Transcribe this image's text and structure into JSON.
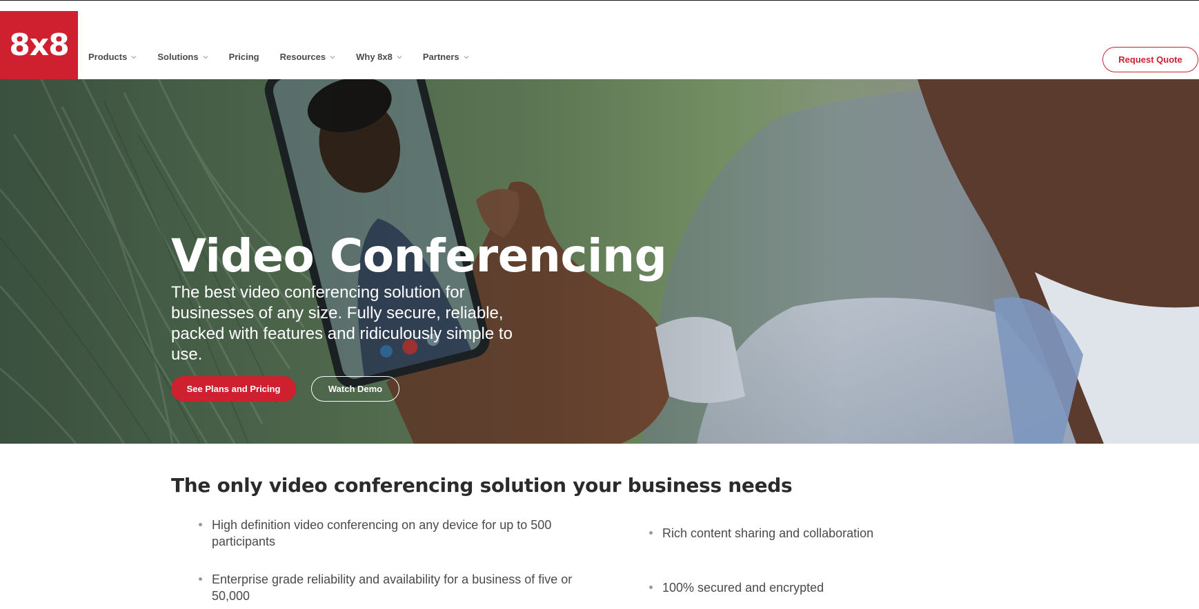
{
  "brand": {
    "logo_text": "8x8",
    "accent_color": "#cf2030"
  },
  "nav": {
    "items": [
      {
        "label": "Products",
        "has_dropdown": true,
        "icon": "chevron-down-icon"
      },
      {
        "label": "Solutions",
        "has_dropdown": true,
        "icon": "chevron-down-icon"
      },
      {
        "label": "Pricing",
        "has_dropdown": false
      },
      {
        "label": "Resources",
        "has_dropdown": true,
        "icon": "chevron-down-icon"
      },
      {
        "label": "Why 8x8",
        "has_dropdown": true,
        "icon": "chevron-down-icon"
      },
      {
        "label": "Partners",
        "has_dropdown": true,
        "icon": "chevron-down-icon"
      }
    ],
    "cta_label": "Request Quote"
  },
  "hero": {
    "title": "Video Conferencing",
    "subtitle": "The best video conferencing solution for businesses of any size. Fully secure, reliable, packed with features and ridiculously simple to use.",
    "primary_button": "See Plans and Pricing",
    "secondary_button": "Watch Demo"
  },
  "features": {
    "title": "The only video conferencing solution your business needs",
    "items": [
      "High definition video conferencing on any device for up to 500 participants",
      "Rich content sharing and collaboration",
      "Enterprise grade reliability and availability for a business of five or 50,000",
      "100% secured and encrypted"
    ]
  }
}
